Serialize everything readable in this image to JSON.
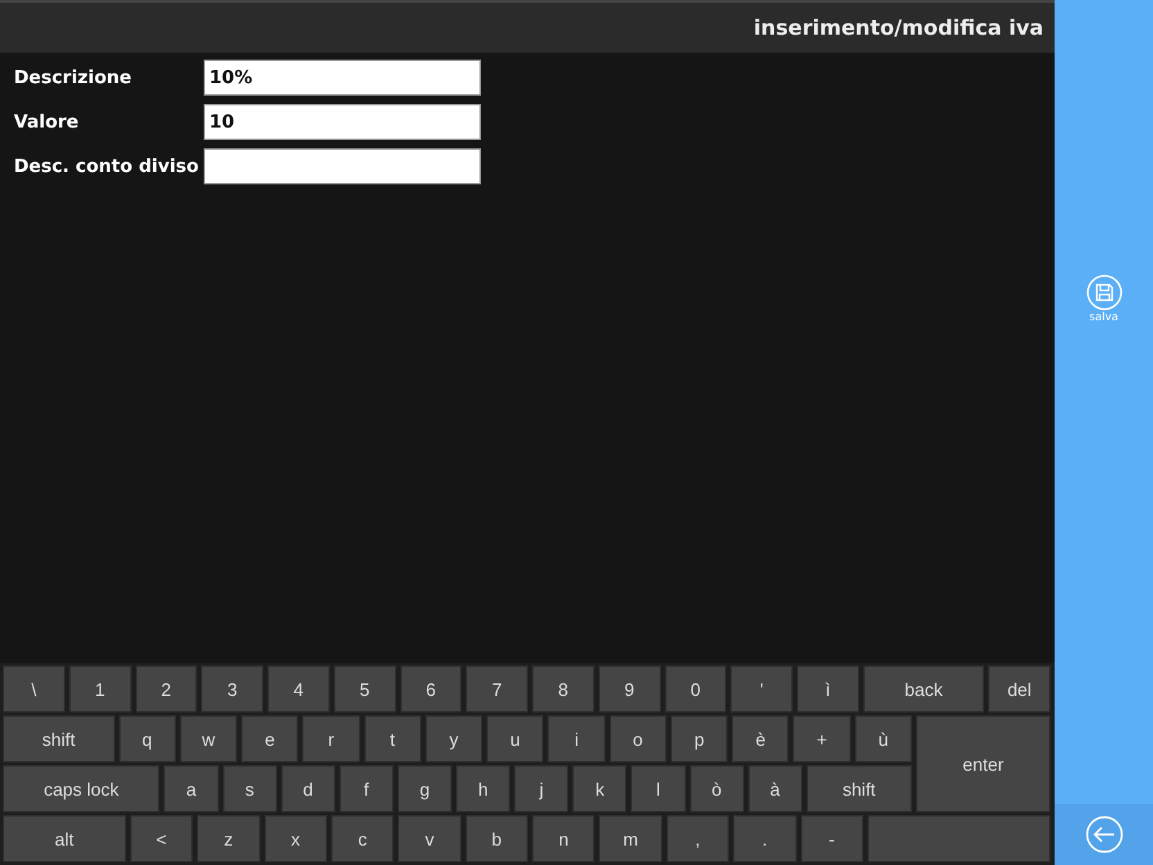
{
  "header": {
    "title": "inserimento/modifica iva"
  },
  "form": [
    {
      "label": "Descrizione",
      "value": "10%"
    },
    {
      "label": "Valore",
      "value": "10"
    },
    {
      "label": "Desc. conto diviso"
    }
  ],
  "sidebar": {
    "save_label": "salva"
  },
  "keyboard": {
    "row_1": [
      {
        "kind": "char",
        "label": "\\"
      },
      {
        "kind": "char",
        "label": "1"
      },
      {
        "kind": "char",
        "label": "2"
      },
      {
        "kind": "char",
        "label": "3"
      },
      {
        "kind": "char",
        "label": "4"
      },
      {
        "kind": "char",
        "label": "5"
      },
      {
        "kind": "char",
        "label": "6"
      },
      {
        "kind": "char",
        "label": "7"
      },
      {
        "kind": "char",
        "label": "8"
      },
      {
        "kind": "char",
        "label": "9"
      },
      {
        "kind": "char",
        "label": "0"
      },
      {
        "kind": "char",
        "label": "'"
      },
      {
        "kind": "char",
        "label": "ì"
      },
      {
        "kind": "wide",
        "label": "back"
      },
      {
        "kind": "char",
        "label": "del"
      }
    ],
    "row_2": [
      {
        "kind": "wide",
        "label": "shift"
      },
      {
        "kind": "char",
        "label": "q"
      },
      {
        "kind": "char",
        "label": "w"
      },
      {
        "kind": "char",
        "label": "e"
      },
      {
        "kind": "char",
        "label": "r"
      },
      {
        "kind": "char",
        "label": "t"
      },
      {
        "kind": "char",
        "label": "y"
      },
      {
        "kind": "char",
        "label": "u"
      },
      {
        "kind": "char",
        "label": "i"
      },
      {
        "kind": "char",
        "label": "o"
      },
      {
        "kind": "char",
        "label": "p"
      },
      {
        "kind": "char",
        "label": "è"
      },
      {
        "kind": "char",
        "label": "+"
      },
      {
        "kind": "char",
        "label": "ù"
      }
    ],
    "row_3": [
      {
        "kind": "caps",
        "label": "caps lock"
      },
      {
        "kind": "char",
        "label": "a"
      },
      {
        "kind": "char",
        "label": "s"
      },
      {
        "kind": "char",
        "label": "d"
      },
      {
        "kind": "char",
        "label": "f"
      },
      {
        "kind": "char",
        "label": "g"
      },
      {
        "kind": "char",
        "label": "h"
      },
      {
        "kind": "char",
        "label": "j"
      },
      {
        "kind": "char",
        "label": "k"
      },
      {
        "kind": "char",
        "label": "l"
      },
      {
        "kind": "char",
        "label": "ò"
      },
      {
        "kind": "char",
        "label": "à"
      },
      {
        "kind": "wide",
        "label": "shift"
      }
    ],
    "enter": "enter",
    "row_4": [
      {
        "kind": "wide",
        "label": "alt"
      },
      {
        "kind": "char",
        "label": "<"
      },
      {
        "kind": "char",
        "label": "z"
      },
      {
        "kind": "char",
        "label": "x"
      },
      {
        "kind": "char",
        "label": "c"
      },
      {
        "kind": "char",
        "label": "v"
      },
      {
        "kind": "char",
        "label": "b"
      },
      {
        "kind": "char",
        "label": "n"
      },
      {
        "kind": "char",
        "label": "m"
      },
      {
        "kind": "char",
        "label": ","
      },
      {
        "kind": "char",
        "label": "."
      },
      {
        "kind": "char",
        "label": "-"
      },
      {
        "kind": "space"
      }
    ]
  }
}
